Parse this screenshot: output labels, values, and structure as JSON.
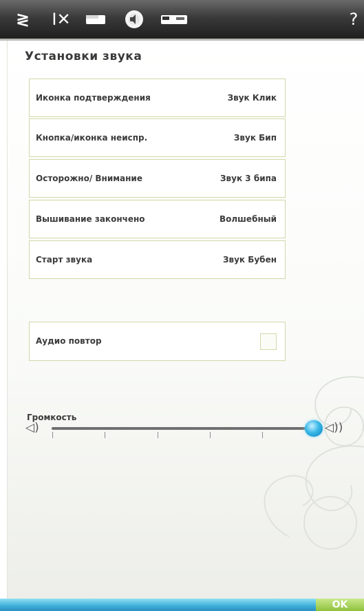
{
  "toolbar": {
    "icons": [
      "stitch-menu-icon",
      "scissors-icon",
      "thread-icon",
      "sound-settings-icon",
      "machine-icon",
      "help-icon"
    ],
    "stitch_glyph": "≷",
    "scissors_glyph": "I✕",
    "help_glyph": "?"
  },
  "page": {
    "title": "Установки звука"
  },
  "settings": [
    {
      "label": "Иконка подтверждения",
      "value": "Звук Клик"
    },
    {
      "label": "Кнопка/иконка неиспр.",
      "value": "Звук Бип"
    },
    {
      "label": "Осторожно/ Внимание",
      "value": "Звук 3 бипа"
    },
    {
      "label": "Вышивание закончено",
      "value": "Волшебный"
    },
    {
      "label": "Старт звука",
      "value": "Звук Бубен"
    }
  ],
  "audio_repeat": {
    "label": "Аудио повтор",
    "checked": false
  },
  "volume": {
    "label": "Громкость",
    "level_fraction": 1.0,
    "min_icon": "speaker-low-icon",
    "max_icon": "speaker-high-icon",
    "min_glyph": "◁)",
    "max_glyph": "◁))"
  },
  "footer": {
    "ok_label": "OK"
  },
  "colors": {
    "accent_border": "#cfd9a8",
    "ok_green": "#8fc13d",
    "slider_blue": "#39b7e8"
  }
}
